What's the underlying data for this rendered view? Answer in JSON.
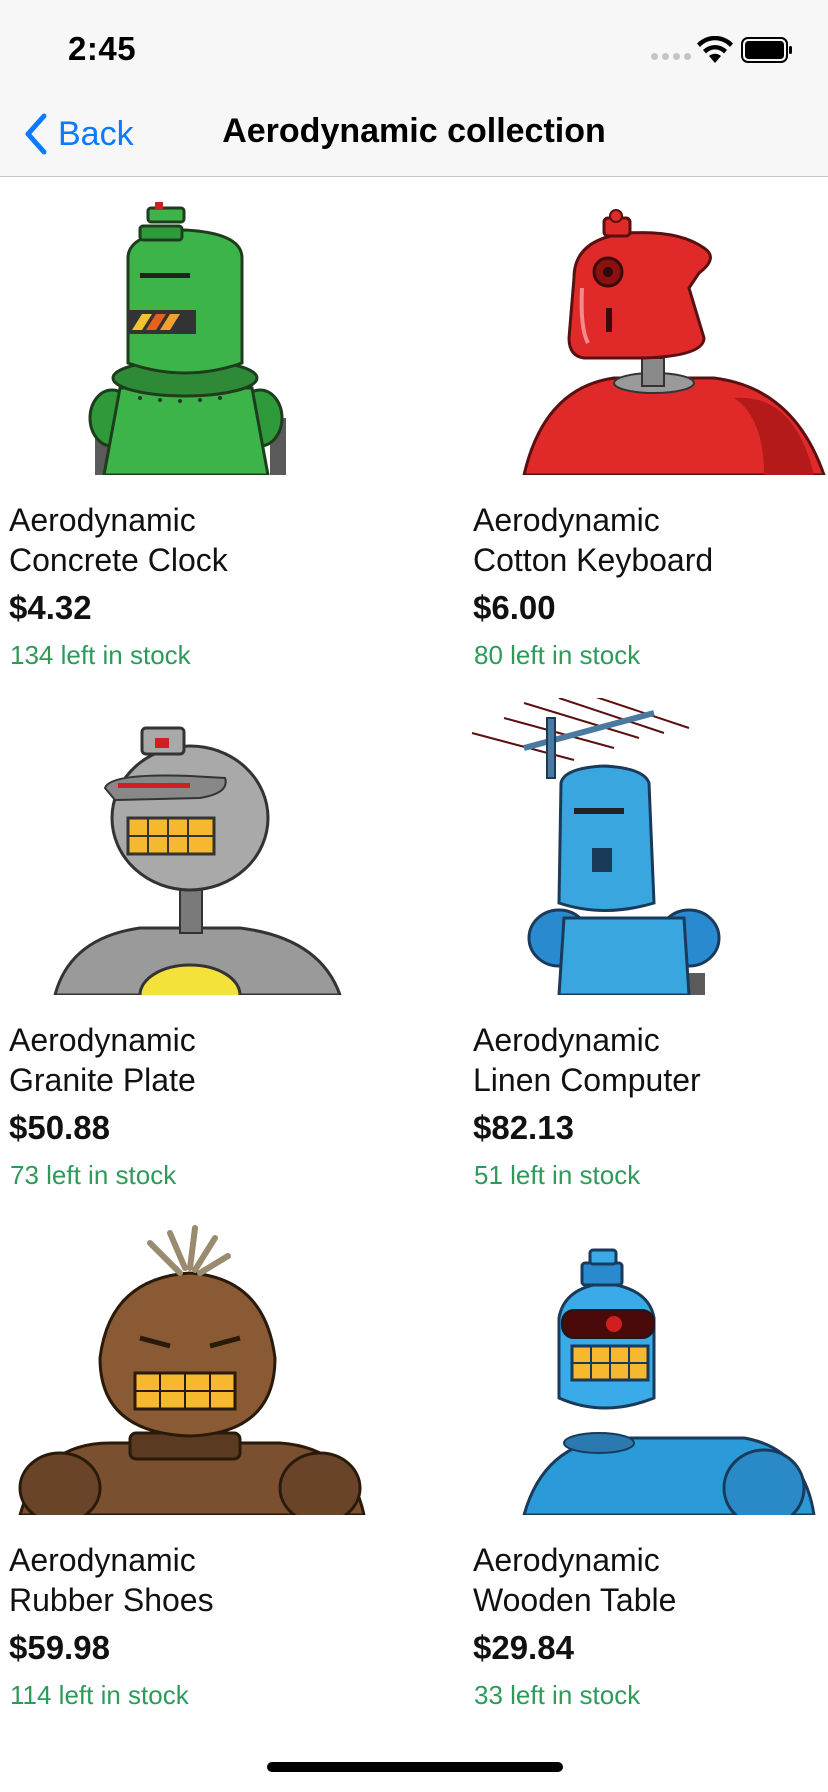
{
  "status_bar": {
    "time": "2:45"
  },
  "nav": {
    "back_label": "Back",
    "title": "Aerodynamic collection"
  },
  "colors": {
    "accent": "#0a7aff",
    "stock_text": "#2e9a5a"
  },
  "products": [
    {
      "name_line1": "Aerodynamic",
      "name_line2": "Concrete Clock",
      "price": "$4.32",
      "stock": "134 left in stock",
      "image": "green-robot"
    },
    {
      "name_line1": "Aerodynamic",
      "name_line2": "Cotton Keyboard",
      "price": "$6.00",
      "stock": "80 left in stock",
      "image": "red-robot"
    },
    {
      "name_line1": "Aerodynamic",
      "name_line2": "Granite Plate",
      "price": "$50.88",
      "stock": "73 left in stock",
      "image": "gray-robot"
    },
    {
      "name_line1": "Aerodynamic",
      "name_line2": "Linen Computer",
      "price": "$82.13",
      "stock": "51 left in stock",
      "image": "blue-antenna-robot"
    },
    {
      "name_line1": "Aerodynamic",
      "name_line2": "Rubber Shoes",
      "price": "$59.98",
      "stock": "114 left in stock",
      "image": "brown-robot"
    },
    {
      "name_line1": "Aerodynamic",
      "name_line2": "Wooden Table",
      "price": "$29.84",
      "stock": "33 left in stock",
      "image": "blue-robot"
    }
  ]
}
